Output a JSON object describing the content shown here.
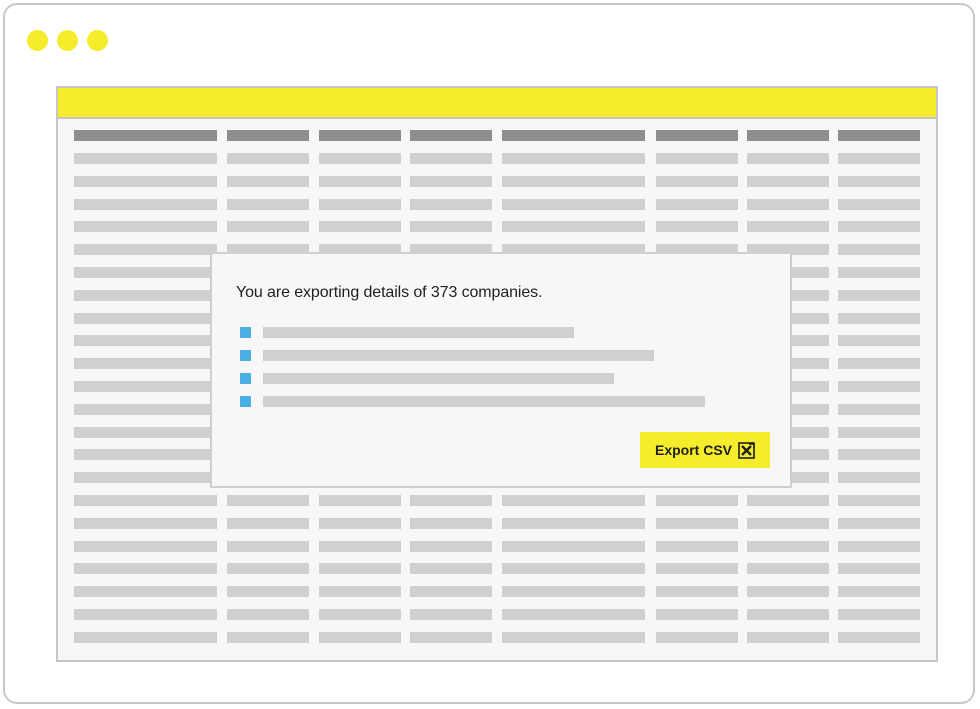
{
  "colors": {
    "accent": "#f5ec2b",
    "bullet": "#4ab0e3",
    "header_bar": "#8e8e8e",
    "row_bar": "#d0d0d0"
  },
  "window": {
    "controls": [
      "dot",
      "dot",
      "dot"
    ]
  },
  "dialog": {
    "title": "You are exporting details of 373 companies.",
    "export_button_label": "Export CSV",
    "export_icon": "excel-icon"
  }
}
